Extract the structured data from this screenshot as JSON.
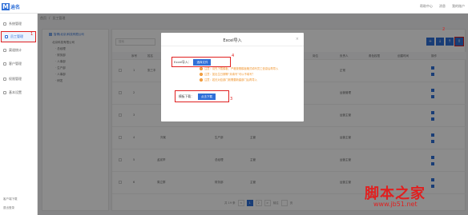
{
  "header": {
    "logo_mark": "M",
    "logo_text": "迪名",
    "links": [
      "帮助中心",
      "消息",
      "我的账户"
    ]
  },
  "sidebar": {
    "items": [
      {
        "label": "系统管理"
      },
      {
        "label": "员工管理"
      },
      {
        "label": "渠道统计"
      },
      {
        "label": "客户管理"
      },
      {
        "label": "权限管理"
      },
      {
        "label": "基本设置"
      }
    ],
    "bottom": [
      "客户端下载",
      "退出登录"
    ]
  },
  "breadcrumb": [
    "首页",
    "/",
    "员工管理"
  ],
  "tree": {
    "title": "智博(北京)科技有限公司",
    "items": [
      "北京科技有限公司",
      "· 总经理",
      "· 财务部",
      "· 人事部",
      "· 生产部",
      "· 人事部",
      "· 研发"
    ]
  },
  "table": {
    "search_placeholder": "搜索",
    "toolbar_icons": [
      "plus-icon",
      "download-icon",
      "upload-icon",
      "import-icon"
    ],
    "columns": [
      "序号",
      "姓名",
      "手机号",
      "所属部门",
      "职务",
      "状态",
      "岗位",
      "负责人",
      "角色权限",
      "创建时间",
      "操作"
    ],
    "rows": [
      {
        "no": "1",
        "name": "张三丰",
        "dept": "总经理",
        "role": "管理员",
        "status": "正常"
      },
      {
        "no": "2",
        "name": "",
        "dept": "",
        "role": "",
        "status": "运营管理"
      },
      {
        "no": "3",
        "name": "",
        "dept": "",
        "role": "",
        "status": "运营主管"
      },
      {
        "no": "4",
        "name": "刘某",
        "dept": "生产部",
        "role": "主管",
        "status": "运营主管"
      },
      {
        "no": "5",
        "name": "孟宪举",
        "dept": "总经理",
        "role": "主管",
        "status": "运营主管"
      },
      {
        "no": "6",
        "name": "周立群",
        "dept": "财务部",
        "role": "主管",
        "status": "运营主管"
      }
    ]
  },
  "pager": {
    "total": "共 19 条",
    "pages": [
      "<",
      "1",
      "2",
      ">"
    ],
    "goto": "前往",
    "page_suffix": "页"
  },
  "modal": {
    "title": "Excel导入",
    "close": "×",
    "import_label": "Excel导入：",
    "import_button": "选择文件",
    "notes": [
      "注意：请先下载模板，严格按照模板格式填写员工信息后再导入",
      "注意：如出生日期等“未填写”可以不填写？",
      "注意：若无对应部门则需要新建部门后再导入"
    ],
    "template_label": "模板下载：",
    "template_button": "点击下载"
  },
  "annotations": {
    "num1": "1",
    "num2": "2",
    "num3": "3",
    "num4": "4"
  },
  "watermark": {
    "text": "脚本之家",
    "url": "www.jb51.net"
  },
  "colors": {
    "accent": "#2e6fd8",
    "highlight": "#e02020",
    "warning": "#f0932b"
  }
}
